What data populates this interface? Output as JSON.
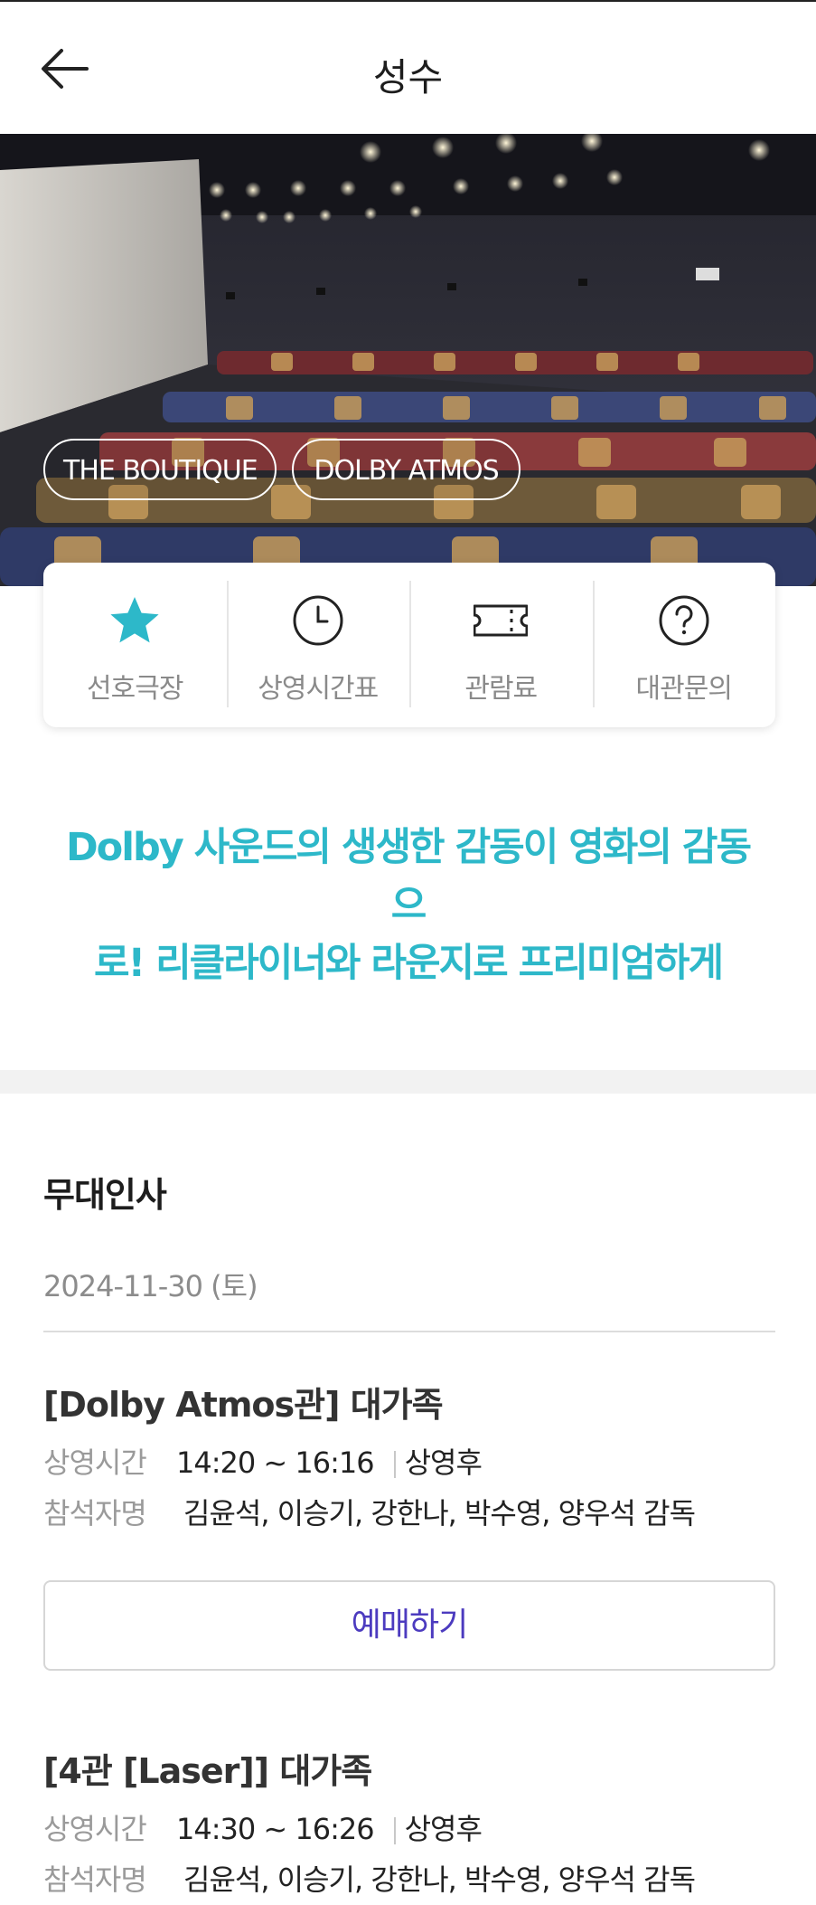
{
  "header": {
    "title": "성수"
  },
  "hero": {
    "tags": [
      "THE BOUTIQUE",
      "DOLBY ATMOS"
    ]
  },
  "quick_menu": [
    {
      "label": "선호극장",
      "icon": "star-icon",
      "color": "#2db8c9"
    },
    {
      "label": "상영시간표",
      "icon": "clock-icon"
    },
    {
      "label": "관람료",
      "icon": "ticket-icon"
    },
    {
      "label": "대관문의",
      "icon": "question-circle-icon"
    }
  ],
  "promo": {
    "line1": "Dolby 사운드의 생생한 감동이 영화의 감동으",
    "line2": "로! 리클라이너와 라운지로 프리미엄하게",
    "color": "#2db8c9"
  },
  "stage_greeting": {
    "title": "무대인사",
    "date": "2024-11-30 (토)",
    "shows": [
      {
        "title": "[Dolby Atmos관] 대가족",
        "time_label": "상영시간",
        "time": "14:20 ~ 16:16",
        "timing": "상영후",
        "guest_label": "참석자명",
        "guests": "김윤석, 이승기, 강한나, 박수영, 양우석 감독",
        "button": "예매하기"
      },
      {
        "title": "[4관 [Laser]] 대가족",
        "time_label": "상영시간",
        "time": "14:30 ~ 16:26",
        "timing": "상영후",
        "guest_label": "참석자명",
        "guests": "김윤석, 이승기, 강한나, 박수영, 양우석 감독"
      }
    ]
  },
  "colors": {
    "accent": "#2db8c9",
    "button_text": "#4c3bbf"
  }
}
